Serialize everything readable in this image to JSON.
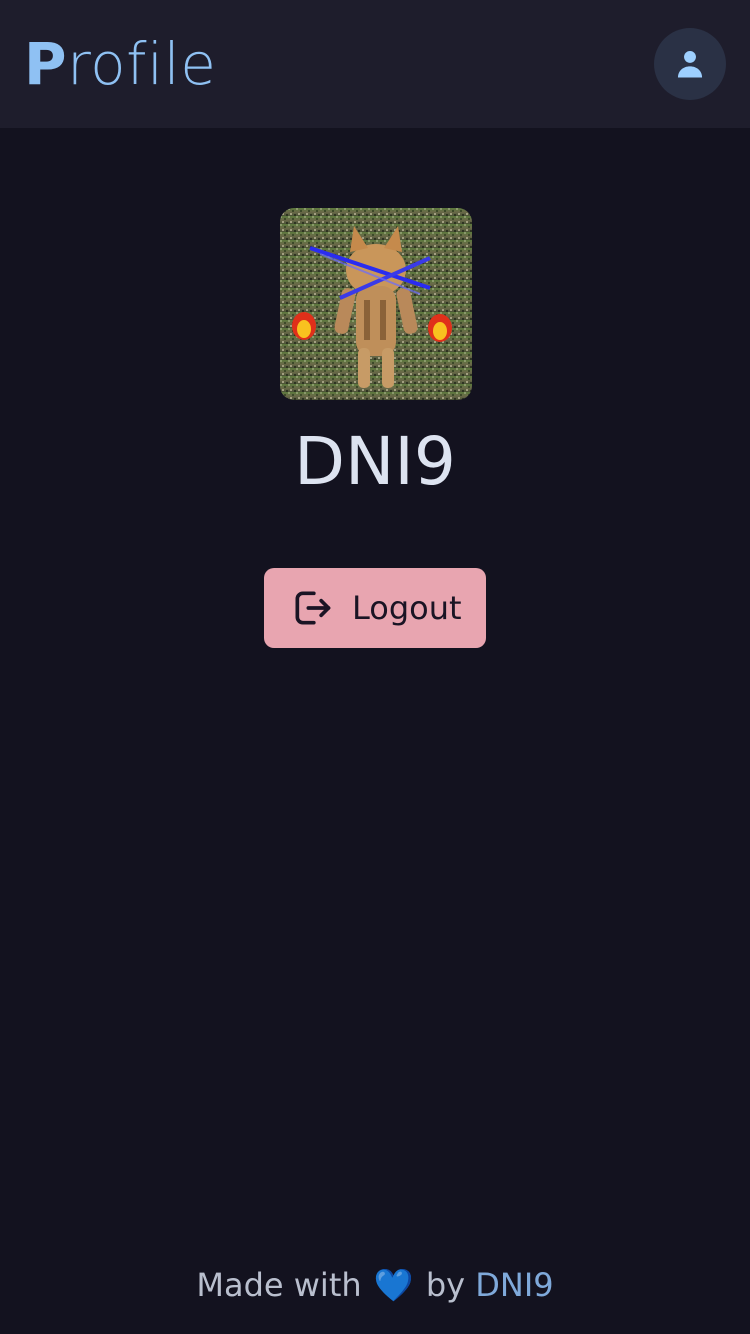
{
  "header": {
    "title_first": "P",
    "title_rest": "rofile",
    "user_icon": "user-icon"
  },
  "profile": {
    "avatar_alt": "avatar",
    "username": "DNI9"
  },
  "actions": {
    "logout_label": "Logout",
    "logout_icon": "logout-icon"
  },
  "footer": {
    "made_with": "Made with",
    "heart": "💙",
    "by": "by",
    "author": "DNI9"
  },
  "colors": {
    "background": "#13121f",
    "header": "#1e1d2c",
    "accent": "#8fc1f3",
    "logout": "#e8a5b0"
  }
}
